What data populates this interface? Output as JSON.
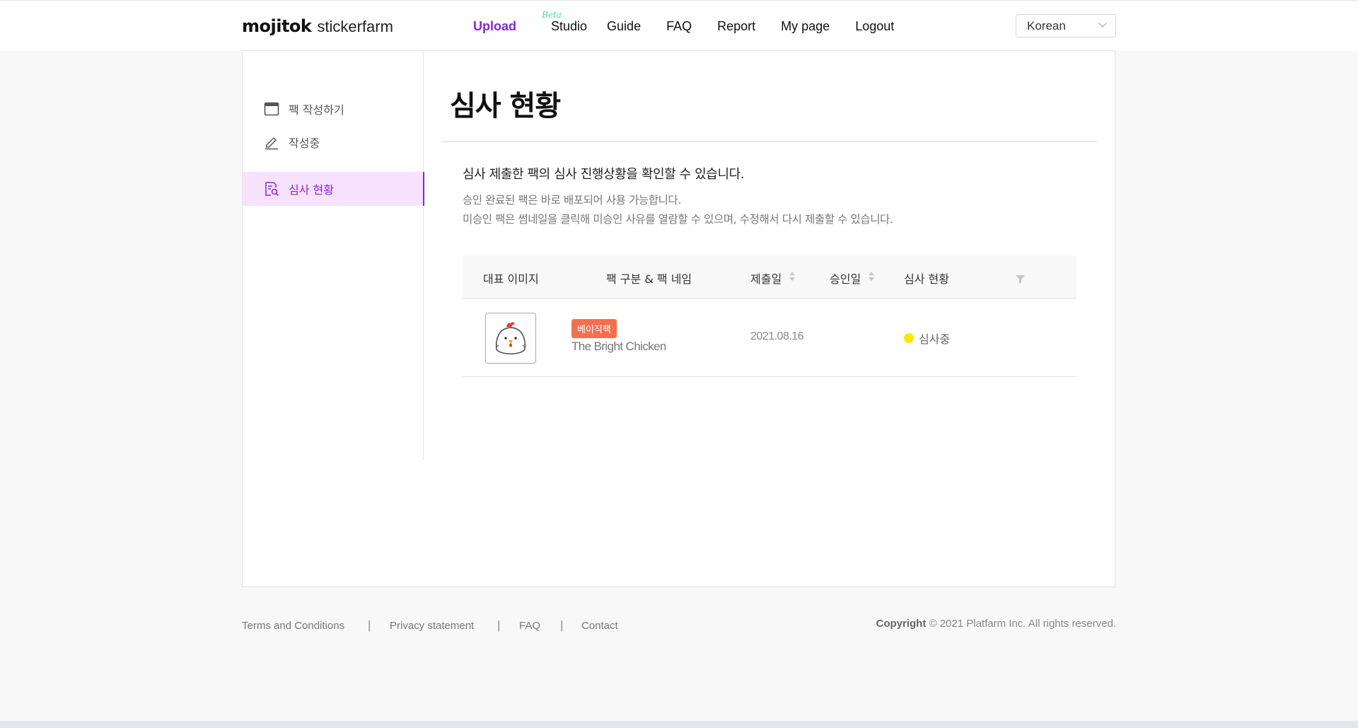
{
  "header": {
    "logo_bold": "mojitok",
    "logo_light": "stickerfarm",
    "nav": [
      {
        "label": "Upload",
        "active": true
      },
      {
        "label": "Studio",
        "badge": "Beta"
      },
      {
        "label": "Guide"
      },
      {
        "label": "FAQ"
      },
      {
        "label": "Report"
      },
      {
        "label": "My page"
      },
      {
        "label": "Logout"
      }
    ],
    "language": "Korean"
  },
  "sidebar": {
    "items": [
      {
        "label": "팩 작성하기",
        "icon": "calendar-icon"
      },
      {
        "label": "작성중",
        "icon": "pencil-icon"
      },
      {
        "label": "심사 현황",
        "icon": "document-search-icon",
        "active": true
      }
    ]
  },
  "main": {
    "title": "심사 현황",
    "lead": "심사 제출한 팩의 심사 진행상황을 확인할 수 있습니다.",
    "sub1": "승인 완료된 팩은 바로 배포되어 사용 가능합니다.",
    "sub2": "미승인 팩은 썸네일을 클릭해 미승인 사유를 열람할 수 있으며, 수정해서 다시 제출할 수 있습니다."
  },
  "table": {
    "headers": {
      "image": "대표 이미지",
      "pack": "팩 구분 & 팩 네임",
      "submitted": "제출일",
      "approved": "승인일",
      "status": "심사 현황"
    },
    "rows": [
      {
        "thumbnail_icon": "chicken-sticker-icon",
        "badge": "베이직팩",
        "badge_color": "#f46f4e",
        "pack_name": "The Bright Chicken",
        "submitted": "2021.08.16",
        "approved": "",
        "status": "심사중",
        "status_color": "#ffe600"
      }
    ]
  },
  "footer": {
    "links": [
      "Terms and Conditions",
      "Privacy statement",
      "FAQ",
      "Contact"
    ],
    "separator": "|",
    "copyright_label": "Copyright",
    "copyright_text": "© 2021 Platfarm Inc. All rights reserved."
  },
  "colors": {
    "accent": "#8a23d8",
    "beta": "#46d9a0",
    "sidebar_active_bg": "#f7e3ff"
  }
}
